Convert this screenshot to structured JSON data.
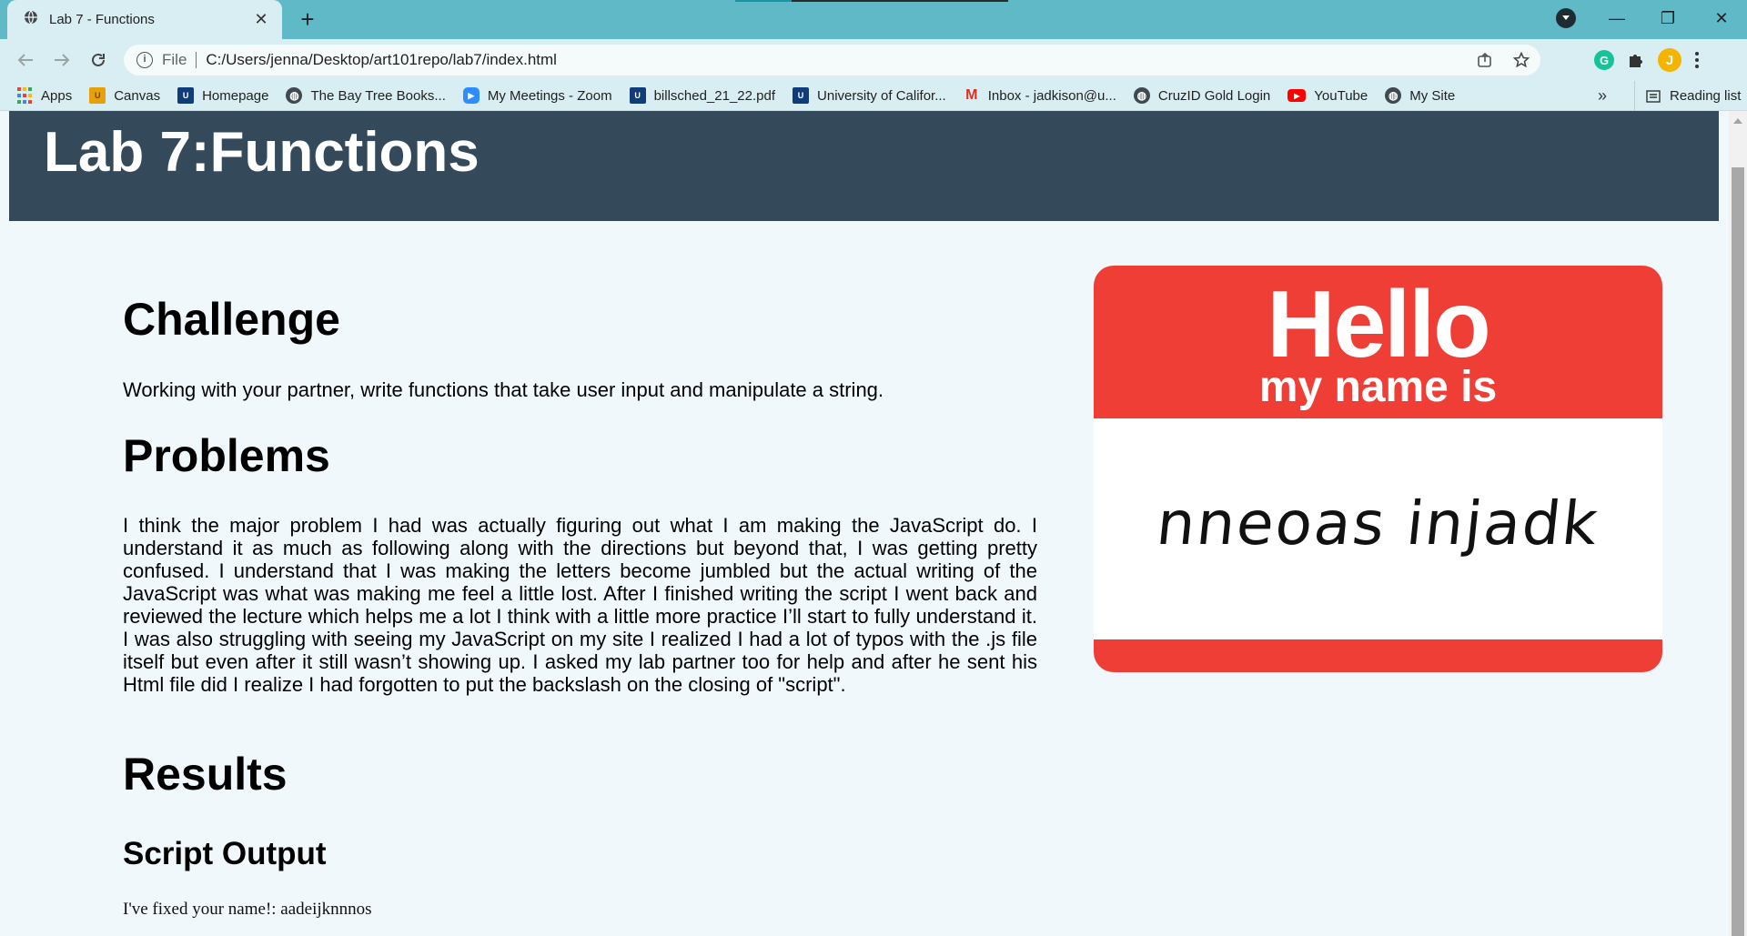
{
  "browser": {
    "tab_title": "Lab 7 - Functions",
    "tab_close": "✕",
    "new_tab": "+",
    "scheme": "File",
    "url": "C:/Users/jenna/Desktop/art101repo/lab7/index.html",
    "avatar_letter": "J",
    "extension_letter": "G",
    "window_controls": {
      "minimize": "—",
      "restore": "❐",
      "close": "✕"
    }
  },
  "bookmarks": {
    "items": [
      {
        "label": "Apps",
        "icon": "apps-grid-icon"
      },
      {
        "label": "Canvas",
        "icon": "canvas-icon"
      },
      {
        "label": "Homepage",
        "icon": "ucsc-icon"
      },
      {
        "label": "The Bay Tree Books...",
        "icon": "globe-icon"
      },
      {
        "label": "My Meetings - Zoom",
        "icon": "zoom-icon"
      },
      {
        "label": "billsched_21_22.pdf",
        "icon": "ucsc-icon"
      },
      {
        "label": "University of Califor...",
        "icon": "ucsc-icon"
      },
      {
        "label": "Inbox - jadkison@u...",
        "icon": "gmail-icon"
      },
      {
        "label": "CruzID Gold Login",
        "icon": "globe-icon"
      },
      {
        "label": "YouTube",
        "icon": "youtube-icon"
      },
      {
        "label": "My Site",
        "icon": "globe-icon"
      }
    ],
    "more": "»",
    "reading_list": "Reading list"
  },
  "page": {
    "header_title": "Lab 7:Functions",
    "challenge_heading": "Challenge",
    "challenge_text": "Working with your partner, write functions that take user input and manipulate a string.",
    "problems_heading": "Problems",
    "problems_text": "I think the major problem I had was actually figuring out what I am making the JavaScript do. I understand it as much as following along with the directions but beyond that, I was getting pretty confused. I understand that I was making the letters become jumbled but the actual writing of the JavaScript was what was making me feel a little lost. After I finished writing the script I went back and reviewed the lecture which helps me a lot I think with a little more practice I’ll start to fully understand it. I was also struggling with seeing my JavaScript on my site I realized I had a lot of typos with the .js file itself but even after it still wasn’t showing up. I asked my lab partner too for help and after he sent his Html file did I realize I had forgotten to put the backslash on the closing of \"script\".",
    "results_heading": "Results",
    "script_output_heading": "Script Output",
    "script_output_text": "I've fixed your name!: aadeijknnnos"
  },
  "nametag": {
    "hello": "Hello",
    "my_name_is": "my name is",
    "handwritten_name": "nneoas injadk"
  },
  "colors": {
    "tabstrip": "#5fb9c6",
    "chrome": "#d9eef2",
    "header_bg": "#34495a",
    "page_bg": "#f1f8fc",
    "nametag_red": "#ef3e36"
  }
}
